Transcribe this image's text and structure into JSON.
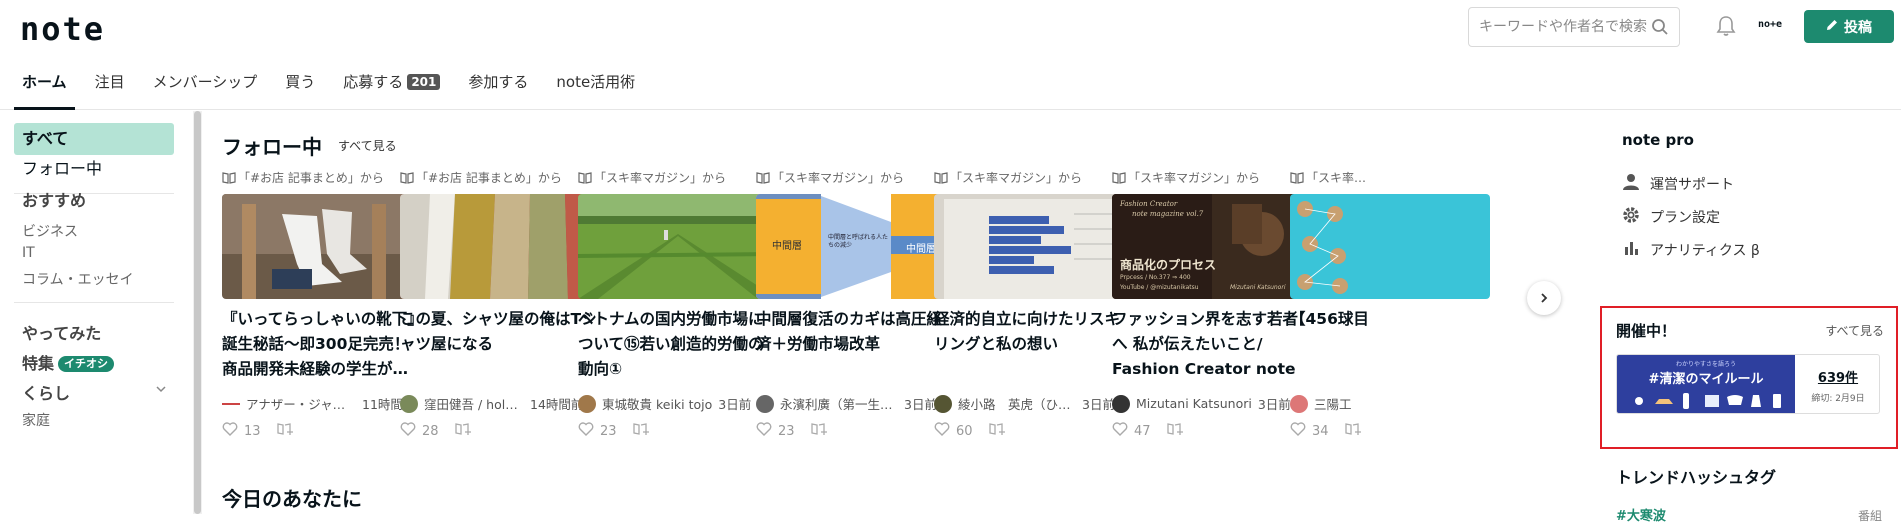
{
  "header": {
    "logo": "note",
    "search_placeholder": "キーワードや作者名で検索",
    "user_label": "no+e",
    "post_label": "投稿"
  },
  "tabs": [
    {
      "label": "ホーム",
      "active": true
    },
    {
      "label": "注目"
    },
    {
      "label": "メンバーシップ"
    },
    {
      "label": "買う"
    },
    {
      "label": "応募する",
      "badge": "201"
    },
    {
      "label": "参加する"
    },
    {
      "label": "note活用術"
    }
  ],
  "sidebar": {
    "all": "すべて",
    "following": "フォロー中",
    "recommended": "おすすめ",
    "business": "ビジネス",
    "it": "IT",
    "column": "コラム・エッセイ",
    "tried": "やってみた",
    "special": "特集",
    "special_badge": "イチオシ",
    "life": "くらし",
    "home": "家庭"
  },
  "main": {
    "following_title": "フォロー中",
    "see_all": "すべて見る",
    "today_title": "今日のあなたに"
  },
  "cards": [
    {
      "from": "「#お店 記事まとめ」から",
      "title": "『いってらっしゃいの靴下』誕生秘話〜即300足完売！商品開発未経験の学生が…",
      "author": "アナザー・ジャパン",
      "time": "11時間前",
      "likes": "13",
      "avatar_color": "#c44"
    },
    {
      "from": "「#お店 記事まとめ」から",
      "title": "この夏、シャツ屋の俺はTシャツ屋になる",
      "author": "窪田健吾 / holo s…",
      "time": "14時間前",
      "likes": "28",
      "avatar_color": "#7a8a5a"
    },
    {
      "from": "「スキ率マガジン」から",
      "title": "ベトナムの国内労働市場について⑮若い創造的労働の動向①",
      "author": "東城敬貴 keiki tojo",
      "time": "3日前",
      "likes": "23",
      "avatar_color": "#a0784a"
    },
    {
      "from": "「スキ率マガジン」から",
      "title": "中間層復活のカギは高圧経済＋労働市場改革",
      "author": "永濱利廣（第一生命…",
      "time": "3日前",
      "likes": "23",
      "avatar_color": "#666"
    },
    {
      "from": "「スキ率マガジン」から",
      "title": "経済的自立に向けたリスキリングと私の想い",
      "author": "綾小路　英虎（ひで…",
      "time": "3日前",
      "likes": "60",
      "avatar_color": "#553"
    },
    {
      "from": "「スキ率マガジン」から",
      "title": "ファッション界を志す若者へ 私が伝えたいこと/ Fashion Creator note mag…",
      "author": "Mizutani Katsunori",
      "time": "3日前",
      "likes": "47",
      "avatar_color": "#333"
    },
    {
      "from": "「スキ率…",
      "title": "【456球目",
      "author": "三陽工",
      "time": "",
      "likes": "34",
      "avatar_color": "#d77"
    }
  ],
  "thumb_texts": {
    "middle_left": "中間層",
    "middle_center": "中間層と呼ばれる人たちの減少",
    "middle_right": "中間層",
    "fashion_top": "Fashion Creator",
    "fashion_sub": "note magazine vol.7",
    "fashion_main": "商品化のプロセス",
    "fashion_process": "Prpcess / No.377 ⇒ 400",
    "fashion_youtube": "YouTube / @mizutanikatsu",
    "fashion_sign": "Mizutani Katsunori"
  },
  "right_panel": {
    "title": "note pro",
    "links": [
      {
        "label": "運営サポート",
        "icon": "person-icon"
      },
      {
        "label": "プラン設定",
        "icon": "gear-icon"
      },
      {
        "label": "アナリティクス β",
        "icon": "analytics-icon"
      }
    ],
    "event_title": "開催中！",
    "event_see_all": "すべて見る",
    "event_small": "わかりやすさを語ろう",
    "event_tag": "#清潔のマイルール",
    "event_count": "639件",
    "event_deadline": "締切: 2月9日",
    "trend_title": "トレンドハッシュタグ",
    "trend_item": "#大寒波",
    "trend_side": "番組"
  },
  "colors": {
    "accent": "#1d8a6f",
    "active_bg": "#b4e3d5",
    "highlight": "#e01e26",
    "event_bg": "#2e3f9e"
  }
}
